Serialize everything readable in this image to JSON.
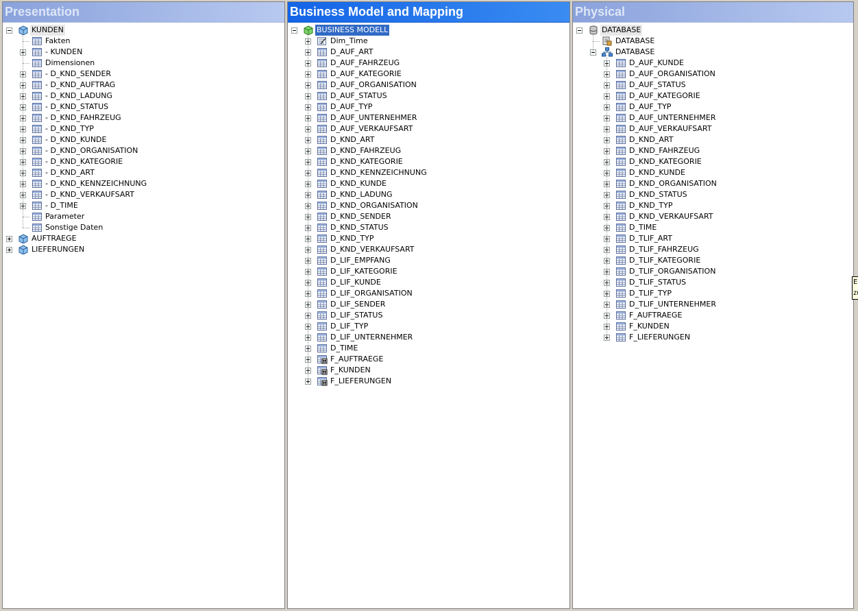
{
  "panes": {
    "presentation": {
      "title": "Presentation",
      "tree": [
        {
          "level": 0,
          "toggle": "minus",
          "icon": "cube-icon",
          "label": "KUNDEN",
          "state": "hl"
        },
        {
          "level": 1,
          "toggle": "none",
          "icon": "table-icon",
          "label": "Fakten"
        },
        {
          "level": 1,
          "toggle": "plus",
          "icon": "table-icon",
          "label": "- KUNDEN"
        },
        {
          "level": 1,
          "toggle": "none",
          "icon": "table-icon",
          "label": "Dimensionen"
        },
        {
          "level": 1,
          "toggle": "plus",
          "icon": "table-icon",
          "label": "- D_KND_SENDER"
        },
        {
          "level": 1,
          "toggle": "plus",
          "icon": "table-icon",
          "label": "- D_KND_AUFTRAG"
        },
        {
          "level": 1,
          "toggle": "plus",
          "icon": "table-icon",
          "label": "- D_KND_LADUNG"
        },
        {
          "level": 1,
          "toggle": "plus",
          "icon": "table-icon",
          "label": "- D_KND_STATUS"
        },
        {
          "level": 1,
          "toggle": "plus",
          "icon": "table-icon",
          "label": "- D_KND_FAHRZEUG"
        },
        {
          "level": 1,
          "toggle": "plus",
          "icon": "table-icon",
          "label": "- D_KND_TYP"
        },
        {
          "level": 1,
          "toggle": "plus",
          "icon": "table-icon",
          "label": "- D_KND_KUNDE"
        },
        {
          "level": 1,
          "toggle": "plus",
          "icon": "table-icon",
          "label": "- D_KND_ORGANISATION"
        },
        {
          "level": 1,
          "toggle": "plus",
          "icon": "table-icon",
          "label": "- D_KND_KATEGORIE"
        },
        {
          "level": 1,
          "toggle": "plus",
          "icon": "table-icon",
          "label": "- D_KND_ART"
        },
        {
          "level": 1,
          "toggle": "plus",
          "icon": "table-icon",
          "label": "- D_KND_KENNZEICHNUNG"
        },
        {
          "level": 1,
          "toggle": "plus",
          "icon": "table-icon",
          "label": "- D_KND_VERKAUFSART"
        },
        {
          "level": 1,
          "toggle": "plus",
          "icon": "table-icon",
          "label": "- D_TIME"
        },
        {
          "level": 1,
          "toggle": "none",
          "icon": "table-icon",
          "label": "Parameter"
        },
        {
          "level": 1,
          "toggle": "none",
          "icon": "table-icon",
          "label": "Sonstige Daten"
        },
        {
          "level": 0,
          "toggle": "plus",
          "icon": "cube-icon",
          "label": "AUFTRAEGE"
        },
        {
          "level": 0,
          "toggle": "plus",
          "icon": "cube-icon",
          "label": "LIEFERUNGEN"
        }
      ]
    },
    "business": {
      "title": "Business Model and Mapping",
      "tree": [
        {
          "level": 0,
          "toggle": "minus",
          "icon": "green-cube-icon",
          "label": "BUSINESS MODELL",
          "state": "sel"
        },
        {
          "level": 1,
          "toggle": "plus",
          "icon": "dimension-icon",
          "label": "Dim_Time"
        },
        {
          "level": 1,
          "toggle": "plus",
          "icon": "table-icon",
          "label": "D_AUF_ART"
        },
        {
          "level": 1,
          "toggle": "plus",
          "icon": "table-icon",
          "label": "D_AUF_FAHRZEUG"
        },
        {
          "level": 1,
          "toggle": "plus",
          "icon": "table-icon",
          "label": "D_AUF_KATEGORIE"
        },
        {
          "level": 1,
          "toggle": "plus",
          "icon": "table-icon",
          "label": "D_AUF_ORGANISATION"
        },
        {
          "level": 1,
          "toggle": "plus",
          "icon": "table-icon",
          "label": "D_AUF_STATUS"
        },
        {
          "level": 1,
          "toggle": "plus",
          "icon": "table-icon",
          "label": "D_AUF_TYP"
        },
        {
          "level": 1,
          "toggle": "plus",
          "icon": "table-icon",
          "label": "D_AUF_UNTERNEHMER"
        },
        {
          "level": 1,
          "toggle": "plus",
          "icon": "table-icon",
          "label": "D_AUF_VERKAUFSART"
        },
        {
          "level": 1,
          "toggle": "plus",
          "icon": "table-icon",
          "label": "D_KND_ART"
        },
        {
          "level": 1,
          "toggle": "plus",
          "icon": "table-icon",
          "label": "D_KND_FAHRZEUG"
        },
        {
          "level": 1,
          "toggle": "plus",
          "icon": "table-icon",
          "label": "D_KND_KATEGORIE"
        },
        {
          "level": 1,
          "toggle": "plus",
          "icon": "table-icon",
          "label": "D_KND_KENNZEICHNUNG"
        },
        {
          "level": 1,
          "toggle": "plus",
          "icon": "table-icon",
          "label": "D_KND_KUNDE"
        },
        {
          "level": 1,
          "toggle": "plus",
          "icon": "table-icon",
          "label": "D_KND_LADUNG"
        },
        {
          "level": 1,
          "toggle": "plus",
          "icon": "table-icon",
          "label": "D_KND_ORGANISATION"
        },
        {
          "level": 1,
          "toggle": "plus",
          "icon": "table-icon",
          "label": "D_KND_SENDER"
        },
        {
          "level": 1,
          "toggle": "plus",
          "icon": "table-icon",
          "label": "D_KND_STATUS"
        },
        {
          "level": 1,
          "toggle": "plus",
          "icon": "table-icon",
          "label": "D_KND_TYP"
        },
        {
          "level": 1,
          "toggle": "plus",
          "icon": "table-icon",
          "label": "D_KND_VERKAUFSART"
        },
        {
          "level": 1,
          "toggle": "plus",
          "icon": "table-icon",
          "label": "D_LIF_EMPFANG"
        },
        {
          "level": 1,
          "toggle": "plus",
          "icon": "table-icon",
          "label": "D_LIF_KATEGORIE"
        },
        {
          "level": 1,
          "toggle": "plus",
          "icon": "table-icon",
          "label": "D_LIF_KUNDE"
        },
        {
          "level": 1,
          "toggle": "plus",
          "icon": "table-icon",
          "label": "D_LIF_ORGANISATION"
        },
        {
          "level": 1,
          "toggle": "plus",
          "icon": "table-icon",
          "label": "D_LIF_SENDER"
        },
        {
          "level": 1,
          "toggle": "plus",
          "icon": "table-icon",
          "label": "D_LIF_STATUS"
        },
        {
          "level": 1,
          "toggle": "plus",
          "icon": "table-icon",
          "label": "D_LIF_TYP"
        },
        {
          "level": 1,
          "toggle": "plus",
          "icon": "table-icon",
          "label": "D_LIF_UNTERNEHMER"
        },
        {
          "level": 1,
          "toggle": "plus",
          "icon": "table-icon",
          "label": "D_TIME"
        },
        {
          "level": 1,
          "toggle": "plus",
          "icon": "fact-table-icon",
          "label": "F_AUFTRAEGE"
        },
        {
          "level": 1,
          "toggle": "plus",
          "icon": "fact-table-icon",
          "label": "F_KUNDEN"
        },
        {
          "level": 1,
          "toggle": "plus",
          "icon": "fact-table-icon",
          "label": "F_LIEFERUNGEN"
        }
      ]
    },
    "physical": {
      "title": "Physical",
      "tree": [
        {
          "level": 0,
          "toggle": "minus",
          "icon": "database-icon",
          "label": "DATABASE",
          "state": "hl"
        },
        {
          "level": 1,
          "toggle": "none",
          "icon": "connection-pool-icon",
          "label": "DATABASE"
        },
        {
          "level": 1,
          "toggle": "minus",
          "icon": "schema-icon",
          "label": "DATABASE"
        },
        {
          "level": 2,
          "toggle": "plus",
          "icon": "table-icon",
          "label": "D_AUF_KUNDE"
        },
        {
          "level": 2,
          "toggle": "plus",
          "icon": "table-icon",
          "label": "D_AUF_ORGANISATION"
        },
        {
          "level": 2,
          "toggle": "plus",
          "icon": "table-icon",
          "label": "D_AUF_STATUS"
        },
        {
          "level": 2,
          "toggle": "plus",
          "icon": "table-icon",
          "label": "D_AUF_KATEGORIE"
        },
        {
          "level": 2,
          "toggle": "plus",
          "icon": "table-icon",
          "label": "D_AUF_TYP"
        },
        {
          "level": 2,
          "toggle": "plus",
          "icon": "table-icon",
          "label": "D_AUF_UNTERNEHMER"
        },
        {
          "level": 2,
          "toggle": "plus",
          "icon": "table-icon",
          "label": "D_AUF_VERKAUFSART"
        },
        {
          "level": 2,
          "toggle": "plus",
          "icon": "table-icon",
          "label": "D_KND_ART"
        },
        {
          "level": 2,
          "toggle": "plus",
          "icon": "table-icon",
          "label": "D_KND_FAHRZEUG"
        },
        {
          "level": 2,
          "toggle": "plus",
          "icon": "table-icon",
          "label": "D_KND_KATEGORIE"
        },
        {
          "level": 2,
          "toggle": "plus",
          "icon": "table-icon",
          "label": "D_KND_KUNDE"
        },
        {
          "level": 2,
          "toggle": "plus",
          "icon": "table-icon",
          "label": "D_KND_ORGANISATION"
        },
        {
          "level": 2,
          "toggle": "plus",
          "icon": "table-icon",
          "label": "D_KND_STATUS"
        },
        {
          "level": 2,
          "toggle": "plus",
          "icon": "table-icon",
          "label": "D_KND_TYP"
        },
        {
          "level": 2,
          "toggle": "plus",
          "icon": "table-icon",
          "label": "D_KND_VERKAUFSART"
        },
        {
          "level": 2,
          "toggle": "plus",
          "icon": "table-icon",
          "label": "D_TIME"
        },
        {
          "level": 2,
          "toggle": "plus",
          "icon": "table-icon",
          "label": "D_TLIF_ART"
        },
        {
          "level": 2,
          "toggle": "plus",
          "icon": "table-icon",
          "label": "D_TLIF_FAHRZEUG"
        },
        {
          "level": 2,
          "toggle": "plus",
          "icon": "table-icon",
          "label": "D_TLIF_KATEGORIE"
        },
        {
          "level": 2,
          "toggle": "plus",
          "icon": "table-icon",
          "label": "D_TLIF_ORGANISATION"
        },
        {
          "level": 2,
          "toggle": "plus",
          "icon": "table-icon",
          "label": "D_TLIF_STATUS"
        },
        {
          "level": 2,
          "toggle": "plus",
          "icon": "table-icon",
          "label": "D_TLIF_TYP"
        },
        {
          "level": 2,
          "toggle": "plus",
          "icon": "table-icon",
          "label": "D_TLIF_UNTERNEHMER"
        },
        {
          "level": 2,
          "toggle": "plus",
          "icon": "table-icon",
          "label": "F_AUFTRAEGE"
        },
        {
          "level": 2,
          "toggle": "plus",
          "icon": "table-icon",
          "label": "F_KUNDEN"
        },
        {
          "level": 2,
          "toggle": "plus",
          "icon": "table-icon",
          "label": "F_LIEFERUNGEN"
        }
      ]
    }
  },
  "tooltip_fragment": "E zu",
  "colors": {
    "active_header": "#1464e6",
    "inactive_header": "#8aa2dc",
    "selection": "#316ac5"
  }
}
